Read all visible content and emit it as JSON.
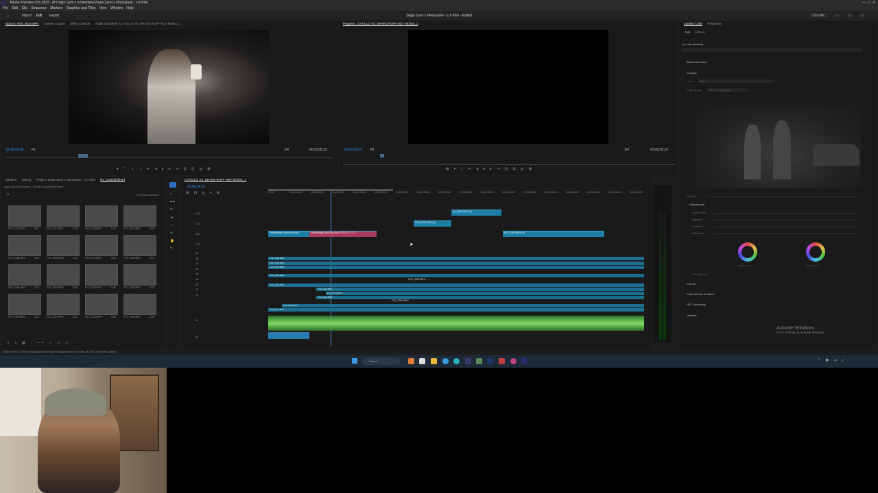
{
  "window": {
    "app_title": "Adobe Premiere Pro 2023 - M:\\zeppi zarni x moneylane\\Zeppi Zarni x Moneylane - Lot Killo",
    "document_title": "Zeppi Zarni x Moneylane - Lot Killo - Edited"
  },
  "menu": [
    "File",
    "Edit",
    "Clip",
    "Sequence",
    "Markers",
    "Graphics and Titles",
    "View",
    "Window",
    "Help"
  ],
  "workspace_tabs": [
    {
      "label": "Import"
    },
    {
      "label": "Edit"
    },
    {
      "label": "Export"
    }
  ],
  "workspace_right": "COLOR",
  "source_panel": {
    "tabs": [
      "Source: FXX_0024.MP4",
      "Lumetri Scopes",
      "Effect Controls",
      "Audio Clip Mixer: LO KILLO VS. DRAKE RUFF NOT MIXED_1"
    ],
    "timecode_left": "23;38;20;36",
    "fit": "Fit",
    "scale": "1/4",
    "timecode_right": "00;00;05;13"
  },
  "program_panel": {
    "tab": "Program: LO KILLO VS. DRAKE RUFF NOT MIXED_1",
    "timecode_left": "00;00;26;01",
    "fit": "Fit",
    "scale": "1/4",
    "timecode_right": "00;00;02;22"
  },
  "project_panel": {
    "tabs": [
      "Markers",
      "History",
      "Project: Zeppi Zarni x Moneylane - Lot Killo",
      "fxx_sorted/refined"
    ],
    "path": "Zeppi Zarni x Moneylane - Lot Killo.prproj\\sorted\\refined",
    "count": "1 of 48 items selected",
    "items": [
      {
        "name": "FXX_0174.MP4",
        "dur": "8;31"
      },
      {
        "name": "FXX_0211.MP4",
        "dur": "3;18"
      },
      {
        "name": "FXX_0166.MP4",
        "dur": "5;19"
      },
      {
        "name": "FXX_0174.MP4",
        "dur": "3;59"
      },
      {
        "name": "FXX_0180.MP4",
        "dur": "3;43"
      },
      {
        "name": "FXX_0189.MP4",
        "dur": "3;47"
      },
      {
        "name": "FXX_0170.MP4",
        "dur": "3;14"
      },
      {
        "name": "FXX_0200.MP4",
        "dur": "2;13"
      },
      {
        "name": "FXX_0181.MP4",
        "dur": "3;18"
      },
      {
        "name": "FXX_0207.MP4",
        "dur": "8;56"
      },
      {
        "name": "FXX_0213.MP4",
        "dur": "4;46"
      },
      {
        "name": "FXX_0215.MP4",
        "dur": "2;29"
      },
      {
        "name": "FXX_0213.MP4",
        "dur": "3;16"
      },
      {
        "name": "FXX_0212.MP4",
        "dur": "5;53"
      },
      {
        "name": "FXX_0224.MP4",
        "dur": "5;08"
      },
      {
        "name": "FXX_0190.MP4",
        "dur": "2;06"
      }
    ]
  },
  "timeline": {
    "sequence_name": "LO KILLO VS. DRAKE RUFF NOT MIXED_1",
    "timecode": "00;00;26;01",
    "ruler": [
      "00;00",
      "00;00;04;00",
      "00;00;08;00",
      "00;00;12;00",
      "00;00;16;00",
      "00;00;20;00",
      "00;00;24;00",
      "00;00;28;00",
      "00;00;32;00",
      "00;00;36;00",
      "00;00;40;00",
      "00;00;44;00",
      "00;00;48;00",
      "00;00;52;00",
      "00;00;56;00",
      "00;01;00;00",
      "00;01;04;00",
      "00;01;08;00"
    ],
    "video_tracks": [
      "V13",
      "V12",
      "V11",
      "V10",
      "V9",
      "V8",
      "V7",
      "V6",
      "V5",
      "V4",
      "V3",
      "V2",
      "V1"
    ],
    "audio_tracks": [
      "A1",
      "A2"
    ],
    "clips": {
      "c1": "fxx_0044.MP4 [V]",
      "c2": "FXX_0041.MP4 [V]",
      "c3": "Saddlebags Band by chuck...",
      "c4": "Saddlebags Band by chuck 2023-07-27 1...",
      "c5": "FXX_0053.MP4 [V]",
      "c6": "FXX_0144.MP4",
      "c7": "FXX_0150.MP4",
      "c8": "FXX_0145.MP4",
      "c9": "FXX_0187.MP4",
      "tl1": "FXX_0138.MP4",
      "tl2": "FXX_0139.MP4",
      "tl3": "FXX_0141.MP4",
      "tl4": "FXX_0169.MP4",
      "tl5": "FXX_0172.MP4",
      "tl6": "FXX_0144.MP4",
      "tl7": "FXX_0171.MP4",
      "tl8": "FXX_0170.MP4",
      "tl9": "FXX_0143.MP4",
      "tl10": "FXX_0117.MP4",
      "mid1": "FXX_0024.MP4",
      "mid2": "FXX_0030.MP4"
    }
  },
  "lumetri": {
    "tabs": [
      "Lumetri Color",
      "Properties"
    ],
    "subtabs": [
      "Edit",
      "Settings"
    ],
    "no_clip": "(no clip selected)",
    "sections": [
      "Basic Correction",
      "Creative",
      "Adjustments",
      "Curves",
      "Color Wheels & Match",
      "HSL Secondary",
      "Vignette"
    ],
    "creative_labels": [
      "Look",
      "Color Space"
    ],
    "look_value": "None",
    "space_value": "Rec. 709 (Scene)",
    "sliders": [
      "Faded Film",
      "Sharpen",
      "Vibrance",
      "Saturation"
    ],
    "wheel_labels": [
      "Shadow Tint",
      "Highlight Tint"
    ],
    "tint_balance": "Tint Balance",
    "intensity": "Intensity"
  },
  "status_bar": "Click to select, or click in empty space and drag to marquee select. Use Shift, Alt, and Ctrl for other options.",
  "watermark": {
    "title": "Activate Windows",
    "subtitle": "Go to Settings to activate Windows."
  },
  "taskbar": {
    "search_placeholder": "Search"
  }
}
